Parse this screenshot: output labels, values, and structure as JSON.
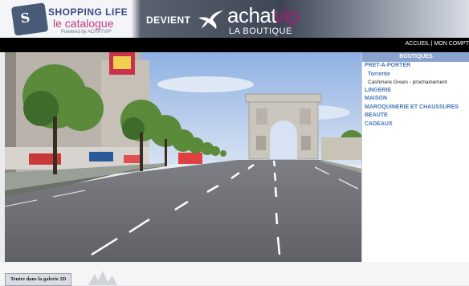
{
  "header": {
    "shoppinglife_line1": "SHOPPING LIFE",
    "shoppinglife_line2": "le catalogue",
    "shoppinglife_line3": "Powered by ACHATVIP",
    "devient": "DEVIENT",
    "brand_achat": "achat",
    "brand_vip": "vip",
    "brand_tagline": "LA BOUTIQUE",
    "accent_pink": "#9a1f6e",
    "accent_blue": "#3a4a88"
  },
  "nav": {
    "accueil": "ACCUEIL",
    "separator": "|",
    "mon_compte": "MON COMPT"
  },
  "panel": {
    "title": "BOUTIQUES",
    "categories": [
      "PRET-A-PORTER",
      "LINGERIE",
      "MAISON",
      "MAROQUINERIE ET CHAUSSURES",
      "BEAUTE",
      "CADEAUX"
    ],
    "submenu_title": "Torrente",
    "submenu_item": "Cashmere Green - prochainement"
  },
  "footer": {
    "gallery_button": "Tentre dans la galerie 2D"
  }
}
